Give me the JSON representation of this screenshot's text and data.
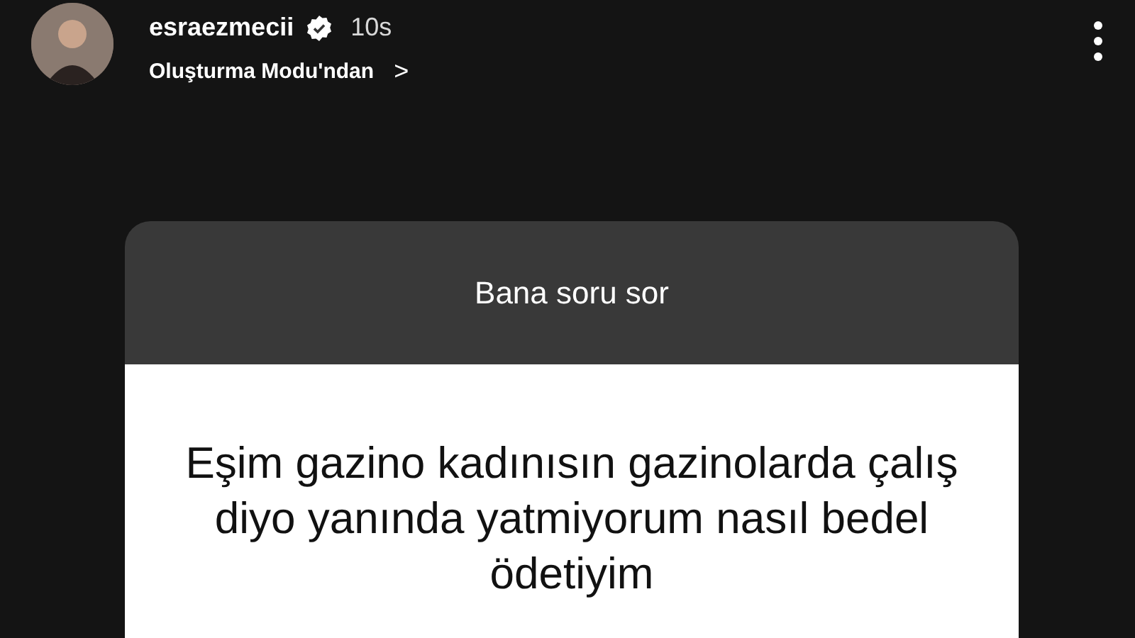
{
  "story_header": {
    "username": "esraezmecii",
    "verified": true,
    "time": "10s",
    "source": "Oluşturma Modu'ndan",
    "source_chevron": ">"
  },
  "question_card": {
    "title": "Bana soru sor",
    "question": "Eşim gazino kadınısın gazinolarda çalış diyo yanında yatmiyorum nasıl bedel ödetiyim"
  }
}
